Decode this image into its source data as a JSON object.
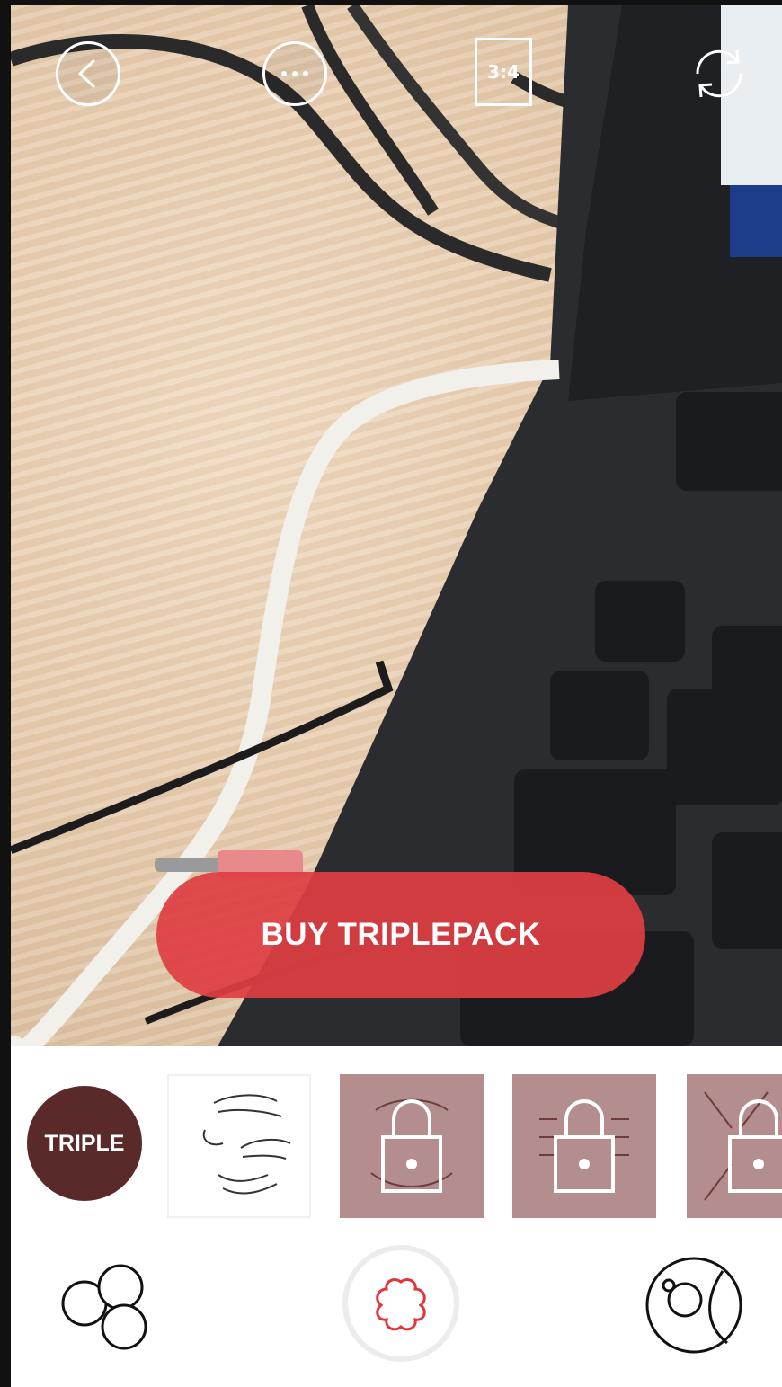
{
  "toolbar": {
    "back_icon": "back-arrow-icon",
    "more_icon": "more-dots-icon",
    "aspect_ratio_label": "3:4",
    "switch_camera_icon": "rotate-camera-icon"
  },
  "camera_preview": {
    "buy_button_label": "BUY TRIPLEPACK",
    "buy_button_color": "#de3e42"
  },
  "sticker_tray": {
    "category_badge": "TRIPLE",
    "category_badge_color": "#5a2a2a",
    "locked_tile_color": "#b48e8e",
    "items": [
      {
        "name": "sticker-free",
        "locked": false
      },
      {
        "name": "sticker-locked-1",
        "locked": true
      },
      {
        "name": "sticker-locked-2",
        "locked": true
      },
      {
        "name": "sticker-locked-3",
        "locked": true
      }
    ]
  },
  "bottom_bar": {
    "left_icon": "bubbles-icon",
    "center_icon": "flower-shutter-icon",
    "center_icon_color": "#e3343a",
    "right_icon": "lens-icon"
  }
}
